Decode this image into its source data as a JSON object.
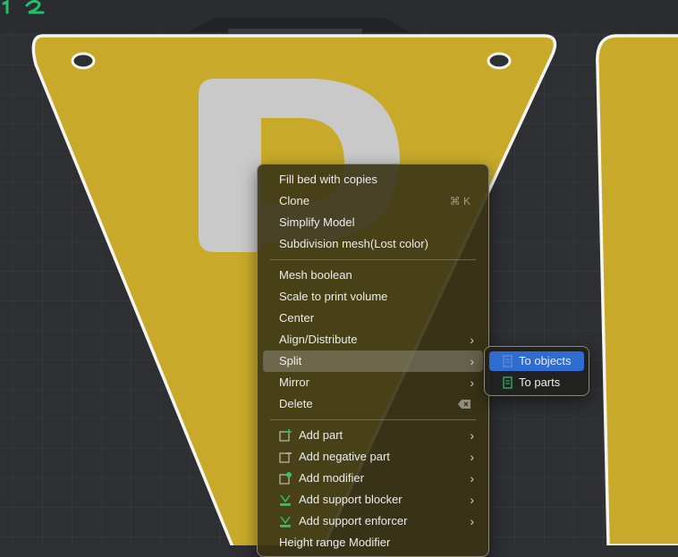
{
  "colors": {
    "bed": "#2e2f33",
    "grid": "#3b3c41",
    "pennant": "#c8a92a",
    "letter": "#c9c9c9",
    "menu_bg": "#3a3414",
    "selection": "#2f6cd1",
    "overlay_text": "#22c06a"
  },
  "context_menu": {
    "group1": [
      {
        "label": "Fill bed with copies"
      },
      {
        "label": "Clone",
        "shortcut": "⌘ K"
      },
      {
        "label": "Simplify Model"
      },
      {
        "label": "Subdivision mesh(Lost color)"
      }
    ],
    "group2": [
      {
        "label": "Mesh boolean"
      },
      {
        "label": "Scale to print volume"
      },
      {
        "label": "Center"
      },
      {
        "label": "Align/Distribute",
        "submenu": true
      },
      {
        "label": "Split",
        "submenu": true,
        "highlighted": true
      },
      {
        "label": "Mirror",
        "submenu": true
      },
      {
        "label": "Delete",
        "shortcut_icon": "delete-key-icon"
      }
    ],
    "group3": [
      {
        "label": "Add part",
        "icon": "add-part-icon",
        "submenu": true
      },
      {
        "label": "Add negative part",
        "icon": "add-negative-part-icon",
        "submenu": true
      },
      {
        "label": "Add modifier",
        "icon": "add-modifier-icon",
        "submenu": true
      },
      {
        "label": "Add support blocker",
        "icon": "support-blocker-icon",
        "submenu": true
      },
      {
        "label": "Add support enforcer",
        "icon": "support-enforcer-icon",
        "submenu": true
      },
      {
        "label": "Height range Modifier"
      }
    ]
  },
  "split_submenu": [
    {
      "label": "To objects",
      "icon": "to-objects-icon",
      "selected": true
    },
    {
      "label": "To parts",
      "icon": "to-parts-icon",
      "selected": false
    }
  ]
}
